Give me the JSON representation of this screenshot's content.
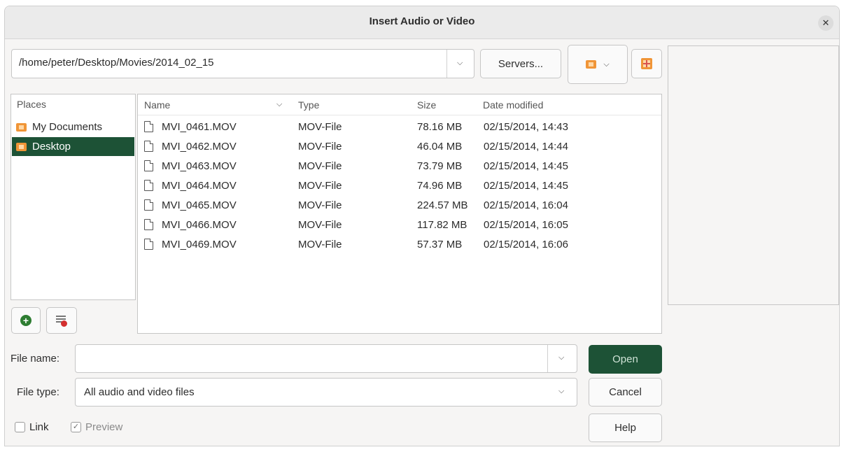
{
  "window": {
    "title": "Insert Audio or Video"
  },
  "path_bar": {
    "value": "/home/peter/Desktop/Movies/2014_02_15"
  },
  "toolbar": {
    "servers_label": "Servers..."
  },
  "places": {
    "header": "Places",
    "items": [
      {
        "label": "My Documents",
        "icon": "folder-icon",
        "selected": false
      },
      {
        "label": "Desktop",
        "icon": "folder-icon",
        "selected": true
      }
    ]
  },
  "files": {
    "columns": {
      "name": "Name",
      "type": "Type",
      "size": "Size",
      "date": "Date modified"
    },
    "rows": [
      {
        "name": "MVI_0461.MOV",
        "type": "MOV-File",
        "size": "78.16 MB",
        "date": "02/15/2014, 14:43"
      },
      {
        "name": "MVI_0462.MOV",
        "type": "MOV-File",
        "size": "46.04 MB",
        "date": "02/15/2014, 14:44"
      },
      {
        "name": "MVI_0463.MOV",
        "type": "MOV-File",
        "size": "73.79 MB",
        "date": "02/15/2014, 14:45"
      },
      {
        "name": "MVI_0464.MOV",
        "type": "MOV-File",
        "size": "74.96 MB",
        "date": "02/15/2014, 14:45"
      },
      {
        "name": "MVI_0465.MOV",
        "type": "MOV-File",
        "size": "224.57 MB",
        "date": "02/15/2014, 16:04"
      },
      {
        "name": "MVI_0466.MOV",
        "type": "MOV-File",
        "size": "117.82 MB",
        "date": "02/15/2014, 16:05"
      },
      {
        "name": "MVI_0469.MOV",
        "type": "MOV-File",
        "size": "57.37 MB",
        "date": "02/15/2014, 16:06"
      }
    ]
  },
  "form": {
    "file_name_label": "File name:",
    "file_name_value": "",
    "file_type_label": "File type:",
    "file_type_value": "All audio and video files",
    "link_label": "Link",
    "link_checked": false,
    "preview_label": "Preview",
    "preview_checked": true
  },
  "buttons": {
    "open": "Open",
    "cancel": "Cancel",
    "help": "Help"
  },
  "colors": {
    "accent": "#1d5236",
    "folder": "#f09537",
    "add_place": "#2e7d32",
    "remove_place": "#d32f2f"
  }
}
